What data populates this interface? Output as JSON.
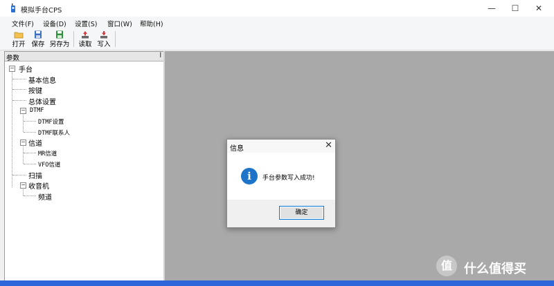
{
  "window": {
    "title": "模拟手台CPS",
    "controls": [
      "—",
      "☐",
      "✕"
    ]
  },
  "menu": [
    "文件(F)",
    "设备(D)",
    "设置(S)",
    "窗口(W)",
    "帮助(H)"
  ],
  "toolbar": {
    "open": "打开",
    "save": "保存",
    "save_as": "另存为",
    "read": "读取",
    "write": "写入"
  },
  "panel": {
    "title": "参数",
    "pin": "ꟾ"
  },
  "tree": {
    "root": "手台",
    "basic_info": "基本信息",
    "keys": "按键",
    "general": "总体设置",
    "dtmf": "DTMF",
    "dtmf_settings": "DTMF设置",
    "dtmf_contacts": "DTMF联系人",
    "channels": "信道",
    "mr_channels": "MR信道",
    "vfo_channels": "VFO信道",
    "scan": "扫描",
    "radio": "收音机",
    "radio_channel": "频道",
    "toggle_expanded": "−"
  },
  "dialog": {
    "title": "信息",
    "close": "✕",
    "icon": "i",
    "message": "手台参数写入成功!",
    "ok": "确定"
  },
  "watermark": {
    "logo": "值",
    "text": "什么值得买"
  },
  "colors": {
    "accent": "#0078d7",
    "info": "#1e74c9",
    "workspace": "#a9a9a9"
  }
}
